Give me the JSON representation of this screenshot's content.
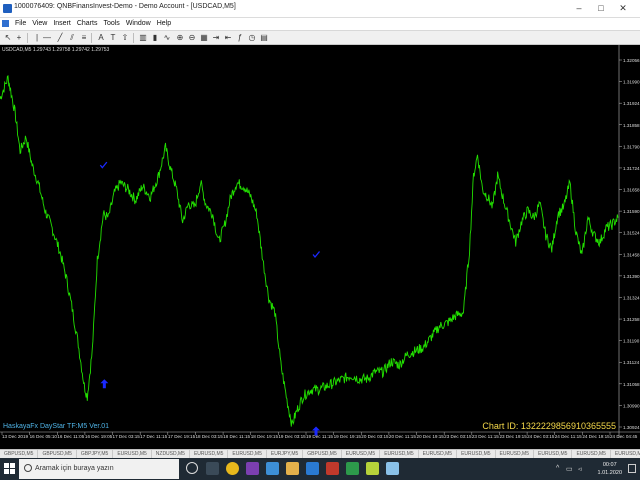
{
  "window": {
    "title": "1000076409: QNBFinansInvest-Demo - Demo Account - [USDCAD,M5]",
    "controls": [
      "–",
      "□",
      "✕"
    ]
  },
  "menu": {
    "items": [
      "File",
      "View",
      "Insert",
      "Charts",
      "Tools",
      "Window",
      "Help"
    ]
  },
  "chart": {
    "header": "USDCAD,M5  1.29743 1.29758 1.29742 1.29753",
    "indicator_label": "HaskayaFx DayStar TF:M5 Ver.01",
    "chart_id": "Chart ID: 1322229856910365555",
    "line_color": "#22e000",
    "arrow_color": "#1a28ff"
  },
  "chart_data": {
    "type": "line",
    "series": [
      {
        "x": [
          0,
          8,
          15,
          20,
          26,
          32,
          38,
          45,
          52,
          60,
          66,
          72,
          78,
          84,
          87,
          92,
          97,
          103,
          108,
          114,
          120,
          128,
          135,
          142,
          150,
          158,
          165,
          170,
          176,
          182,
          188,
          194,
          200,
          205,
          212,
          218,
          224,
          230,
          236,
          243,
          250,
          256,
          262,
          268,
          274,
          280,
          286,
          291,
          296,
          302,
          310,
          318,
          326,
          334,
          342,
          350,
          358,
          366,
          374,
          382,
          390,
          398,
          406,
          414,
          422,
          430,
          438,
          446,
          454,
          462,
          468,
          472,
          476,
          481,
          486,
          491,
          496,
          502,
          508,
          514,
          520,
          526,
          532,
          538,
          544,
          550,
          556,
          562,
          568,
          574,
          580,
          586,
          592,
          598,
          604,
          610,
          616
        ],
        "y": [
          1.3183,
          1.3189,
          1.3179,
          1.3168,
          1.3172,
          1.3164,
          1.3159,
          1.3151,
          1.3146,
          1.3139,
          1.3132,
          1.3123,
          1.3113,
          1.3101,
          1.3098,
          1.3111,
          1.3137,
          1.315,
          1.3149,
          1.3156,
          1.3159,
          1.3157,
          1.3154,
          1.3158,
          1.3155,
          1.3161,
          1.3169,
          1.3163,
          1.3157,
          1.3148,
          1.3153,
          1.3152,
          1.3159,
          1.3153,
          1.315,
          1.3142,
          1.3147,
          1.3155,
          1.3159,
          1.3158,
          1.3155,
          1.315,
          1.3137,
          1.3126,
          1.3122,
          1.3107,
          1.3097,
          1.309,
          1.3094,
          1.3098,
          1.31,
          1.31,
          1.3101,
          1.3102,
          1.3103,
          1.3104,
          1.3103,
          1.3103,
          1.3105,
          1.3105,
          1.3108,
          1.3107,
          1.311,
          1.3111,
          1.3112,
          1.3115,
          1.3118,
          1.3119,
          1.3121,
          1.3122,
          1.314,
          1.3161,
          1.3167,
          1.3157,
          1.3155,
          1.3152,
          1.3161,
          1.3154,
          1.3148,
          1.3142,
          1.3148,
          1.3151,
          1.3149,
          1.3153,
          1.3144,
          1.314,
          1.315,
          1.3152,
          1.3159,
          1.3145,
          1.3138,
          1.3149,
          1.3144,
          1.3142,
          1.3146,
          1.3147,
          1.3149
        ]
      }
    ],
    "ylim": [
      1.3089,
      1.3196
    ],
    "xlim": [
      0,
      616
    ],
    "y_tick_labels": [
      "1.32056",
      "1.31990",
      "1.31924",
      "1.31858",
      "1.31790",
      "1.31724",
      "1.31658",
      "1.31590",
      "1.31524",
      "1.31458",
      "1.31390",
      "1.31324",
      "1.31258",
      "1.31190",
      "1.31124",
      "1.31058",
      "1.30990",
      "1.30924"
    ],
    "x_tick_labels": [
      "13 Dec 2019",
      "16 Dec 05:10",
      "16 Dec 11:05",
      "16 Dec 19:05",
      "17 Dec 03:15",
      "17 Dec 11:15",
      "17 Dec 19:15",
      "18 Dec 03:15",
      "18 Dec 11:15",
      "18 Dec 19:15",
      "19 Dec 03:15",
      "19 Dec 11:15",
      "19 Dec 19:15",
      "20 Dec 03:15",
      "20 Dec 11:15",
      "20 Dec 19:15",
      "23 Dec 03:15",
      "23 Dec 11:15",
      "23 Dec 19:15",
      "24 Dec 03:15",
      "24 Dec 11:15",
      "24 Dec 19:15",
      "24 Dec 04:45"
    ],
    "markers": [
      {
        "kind": "check",
        "x": 103,
        "y": 1.3164
      },
      {
        "kind": "arrow-up",
        "x": 104,
        "y": 1.31015
      },
      {
        "kind": "check",
        "x": 315,
        "y": 1.31385
      },
      {
        "kind": "arrow-up",
        "x": 315,
        "y": 1.3088
      }
    ],
    "grid": false,
    "title": "",
    "xlabel": "",
    "ylabel": ""
  },
  "tabs": [
    "GBPUSD,M5",
    "GBPUSD,M5",
    "GBPJPY,M5",
    "EURUSD,M5",
    "NZDUSD,M5",
    "EURUSD,M5",
    "EURUSD,M5",
    "EURJPY,M5",
    "GBPUSD,M5",
    "EURUSD,M5",
    "EURUSD,M5",
    "EURUSD,M5",
    "EURUSD,M5",
    "EURUSD,M5",
    "EURUSD,M5",
    "EURUSD,M5",
    "EURUSD,M5",
    "USDCAD,M5"
  ],
  "active_tab_index": 17,
  "taskbar": {
    "search_placeholder": "Aramak için buraya yazın",
    "time": "00:07",
    "date": "1.01.2020"
  }
}
